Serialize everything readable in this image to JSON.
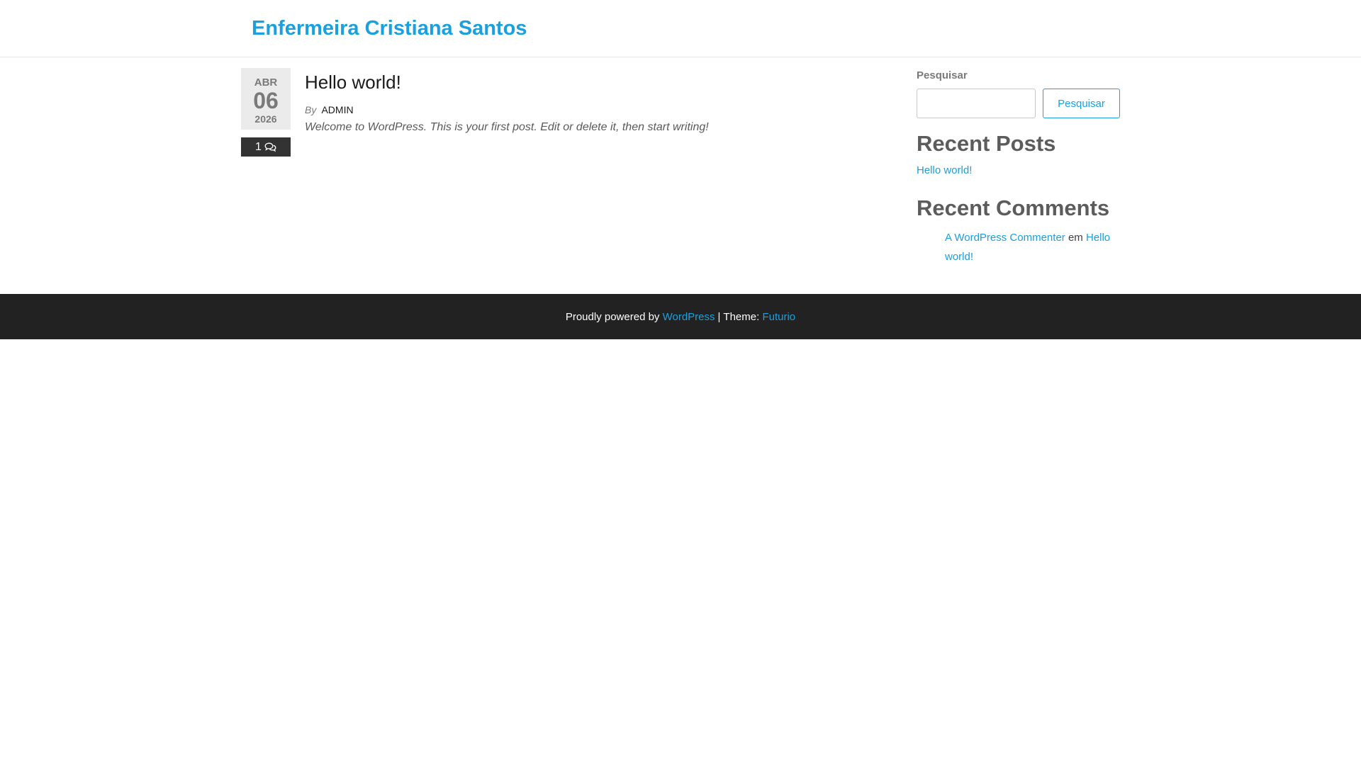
{
  "header": {
    "site_title": "Enfermeira Cristiana Santos"
  },
  "post": {
    "date": {
      "month": "ABR",
      "day": "06",
      "year": "2026"
    },
    "comment_count": "1",
    "title": "Hello world!",
    "by_label": "By",
    "author": "ADMIN",
    "excerpt": "Welcome to WordPress. This is your first post. Edit or delete it, then start writing!"
  },
  "sidebar": {
    "search": {
      "label": "Pesquisar",
      "input_value": "",
      "button_label": "Pesquisar"
    },
    "recent_posts": {
      "title": "Recent Posts",
      "items": [
        {
          "label": "Hello world!"
        }
      ]
    },
    "recent_comments": {
      "title": "Recent Comments",
      "items": [
        {
          "author": "A WordPress Commenter",
          "connector": "em",
          "post": "Hello world!"
        }
      ]
    }
  },
  "footer": {
    "powered_text": "Proudly powered by",
    "wordpress_link": "WordPress",
    "separator": "|",
    "theme_text": "Theme:",
    "theme_link": "Futurio"
  },
  "colors": {
    "accent": "#1aa0dc",
    "footer_bg": "#222222",
    "date_bg": "#ebebeb",
    "badge_bg": "#333333"
  },
  "icons": {
    "comments": "comments-icon"
  }
}
